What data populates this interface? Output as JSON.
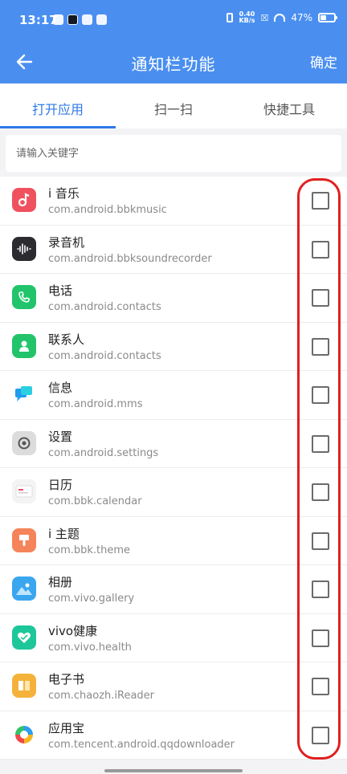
{
  "status_bar": {
    "time": "13:17",
    "speed_top": "0.40",
    "speed_bottom": "KB/s",
    "battery": "47%"
  },
  "header": {
    "title": "通知栏功能",
    "confirm_label": "确定"
  },
  "tabs": [
    {
      "label": "打开应用",
      "active": true
    },
    {
      "label": "扫一扫",
      "active": false
    },
    {
      "label": "快捷工具",
      "active": false
    }
  ],
  "search": {
    "placeholder": "请输入关键字",
    "value": ""
  },
  "apps": [
    {
      "name": "i 音乐",
      "package": "com.android.bbkmusic",
      "icon": "music-icon",
      "color": "#f0515f",
      "checked": false
    },
    {
      "name": "录音机",
      "package": "com.android.bbksoundrecorder",
      "icon": "recorder-icon",
      "color": "#2b2b30",
      "checked": false
    },
    {
      "name": "电话",
      "package": "com.android.contacts",
      "icon": "phone-icon",
      "color": "#21c46a",
      "checked": false
    },
    {
      "name": "联系人",
      "package": "com.android.contacts",
      "icon": "contacts-icon",
      "color": "#21c46a",
      "checked": false
    },
    {
      "name": "信息",
      "package": "com.android.mms",
      "icon": "messages-icon",
      "color": "#1f9cf0",
      "checked": false
    },
    {
      "name": "设置",
      "package": "com.android.settings",
      "icon": "settings-icon",
      "color": "#d9d9d9",
      "checked": false
    },
    {
      "name": "日历",
      "package": "com.bbk.calendar",
      "icon": "calendar-icon",
      "color": "#f2f2f2",
      "checked": false
    },
    {
      "name": "i 主题",
      "package": "com.bbk.theme",
      "icon": "theme-icon",
      "color": "#f5845a",
      "checked": false
    },
    {
      "name": "相册",
      "package": "com.vivo.gallery",
      "icon": "gallery-icon",
      "color": "#3aa6f0",
      "checked": false
    },
    {
      "name": "vivo健康",
      "package": "com.vivo.health",
      "icon": "health-icon",
      "color": "#1ec79a",
      "checked": false
    },
    {
      "name": "电子书",
      "package": "com.chaozh.iReader",
      "icon": "ebook-icon",
      "color": "#f5b23a",
      "checked": false
    },
    {
      "name": "应用宝",
      "package": "com.tencent.android.qqdownloader",
      "icon": "appstore-icon",
      "color": "#ffffff",
      "checked": false
    }
  ],
  "accent_color": "#4a8ff0",
  "highlight_color": "#e02020"
}
